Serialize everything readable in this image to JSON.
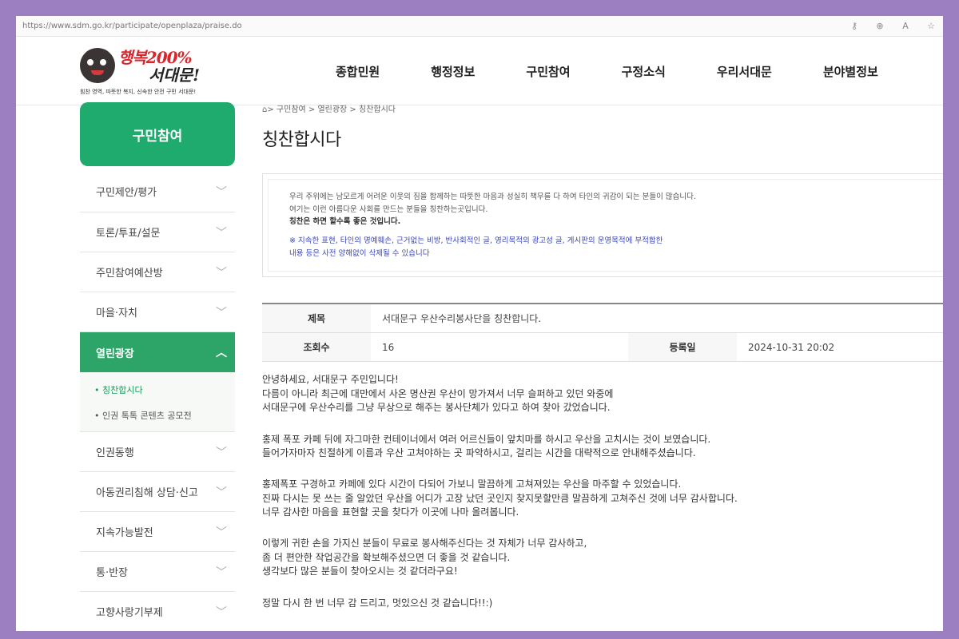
{
  "browser": {
    "url": "https://www.sdm.go.kr/participate/openplaza/praise.do",
    "tool_icons": [
      "key-icon",
      "zoom-icon",
      "read-aloud-icon",
      "favorite-icon"
    ]
  },
  "logo": {
    "line1": "행복200%",
    "line2": "서대문!",
    "tagline": "힘찬 영역, 따뜻한 복지, 신속한 안전 구민 서대문!"
  },
  "gnb": [
    "종합민원",
    "행정정보",
    "구민참여",
    "구정소식",
    "우리서대문",
    "분야별정보"
  ],
  "sidebar": {
    "title": "구민참여",
    "items": [
      {
        "label": "구민제안/평가"
      },
      {
        "label": "토론/투표/설문"
      },
      {
        "label": "주민참여예산방"
      },
      {
        "label": "마을·자치"
      },
      {
        "label": "열린광장"
      }
    ],
    "sub_items": [
      "칭찬합시다",
      "인권 톡톡 콘텐츠 공모전"
    ],
    "items_after": [
      {
        "label": "인권동행"
      },
      {
        "label": "아동권리침해 상담·신고"
      },
      {
        "label": "지속가능발전"
      },
      {
        "label": "통·반장"
      },
      {
        "label": "고향사랑기부제"
      }
    ]
  },
  "breadcrumb": "> 구민참여 > 열린광장 > 칭찬합시다",
  "page_title": "칭찬합시다",
  "notice": {
    "line1": "우리 주위에는 남모르게 어려운 이웃의 짐을 함께하는 따뜻한 마음과 성실히 책무를 다 하여 타인의 귀감이 되는 분들이 많습니다.",
    "line2": "여기는 이런 아름다운 사회를 만드는 분들을 칭찬하는곳입니다.",
    "line3": "칭찬은 하면 할수록 좋은 것입니다.",
    "warn1": "※ 지속한 표현, 타인의 명예훼손, 근거없는 비방, 반사회적인 글, 영리목적의 광고성 글, 게시판의 운영목적에 부적합한",
    "warn2": "내용 등은 사전 양해없이 삭제될 수 있습니다"
  },
  "post": {
    "title_label": "제목",
    "title": "서대문구 우산수리봉사단을 칭찬합니다.",
    "views_label": "조회수",
    "views": "16",
    "date_label": "등록일",
    "date": "2024-10-31 20:02",
    "paragraphs": [
      [
        "안녕하세요, 서대문구 주민입니다!",
        "다름이 아니라 최근에 대만에서 사온 명산권 우산이 망가져서 너무 슬퍼하고 있던 와중에",
        "서대문구에 우산수리를 그냥 무상으로 해주는 봉사단체가 있다고 하여 찾아 갔었습니다."
      ],
      [
        "홍제 폭포 카페 뒤에 자그마한 컨테이너에서 여러 어르신들이 앞치마를 하시고 우산을 고치시는 것이 보였습니다.",
        "들어가자마자 친절하게 이름과 우산 고쳐야하는 곳 파악하시고, 걸리는 시간을 대략적으로 안내해주셨습니다."
      ],
      [
        "홍제폭포 구경하고 카페에 있다 시간이 다되어 가보니 말끔하게 고쳐져있는 우산을 마주할 수 있었습니다.",
        "진짜 다시는 못 쓰는 줄 알았던 우산을 어디가 고장 났던 곳인지 찾지못할만큼 말끔하게 고쳐주신 것에 너무 감사합니다.",
        "너무 감사한 마음을 표현할 곳을 찾다가 이곳에 나마 올려봅니다."
      ],
      [
        "이렇게 귀한 손을 가지신 분들이 무료로 봉사해주신다는 것 자체가 너무 감사하고,",
        "좀 더 편안한 작업공간을 확보해주셨으면 더 좋을 것 같습니다.",
        "생각보다 많은 분들이 찾아오시는 것 같더라구요!"
      ],
      [
        "정말 다시 한 번 너무 감 드리고, 멋있으신 것 같습니다!!:)"
      ]
    ]
  }
}
